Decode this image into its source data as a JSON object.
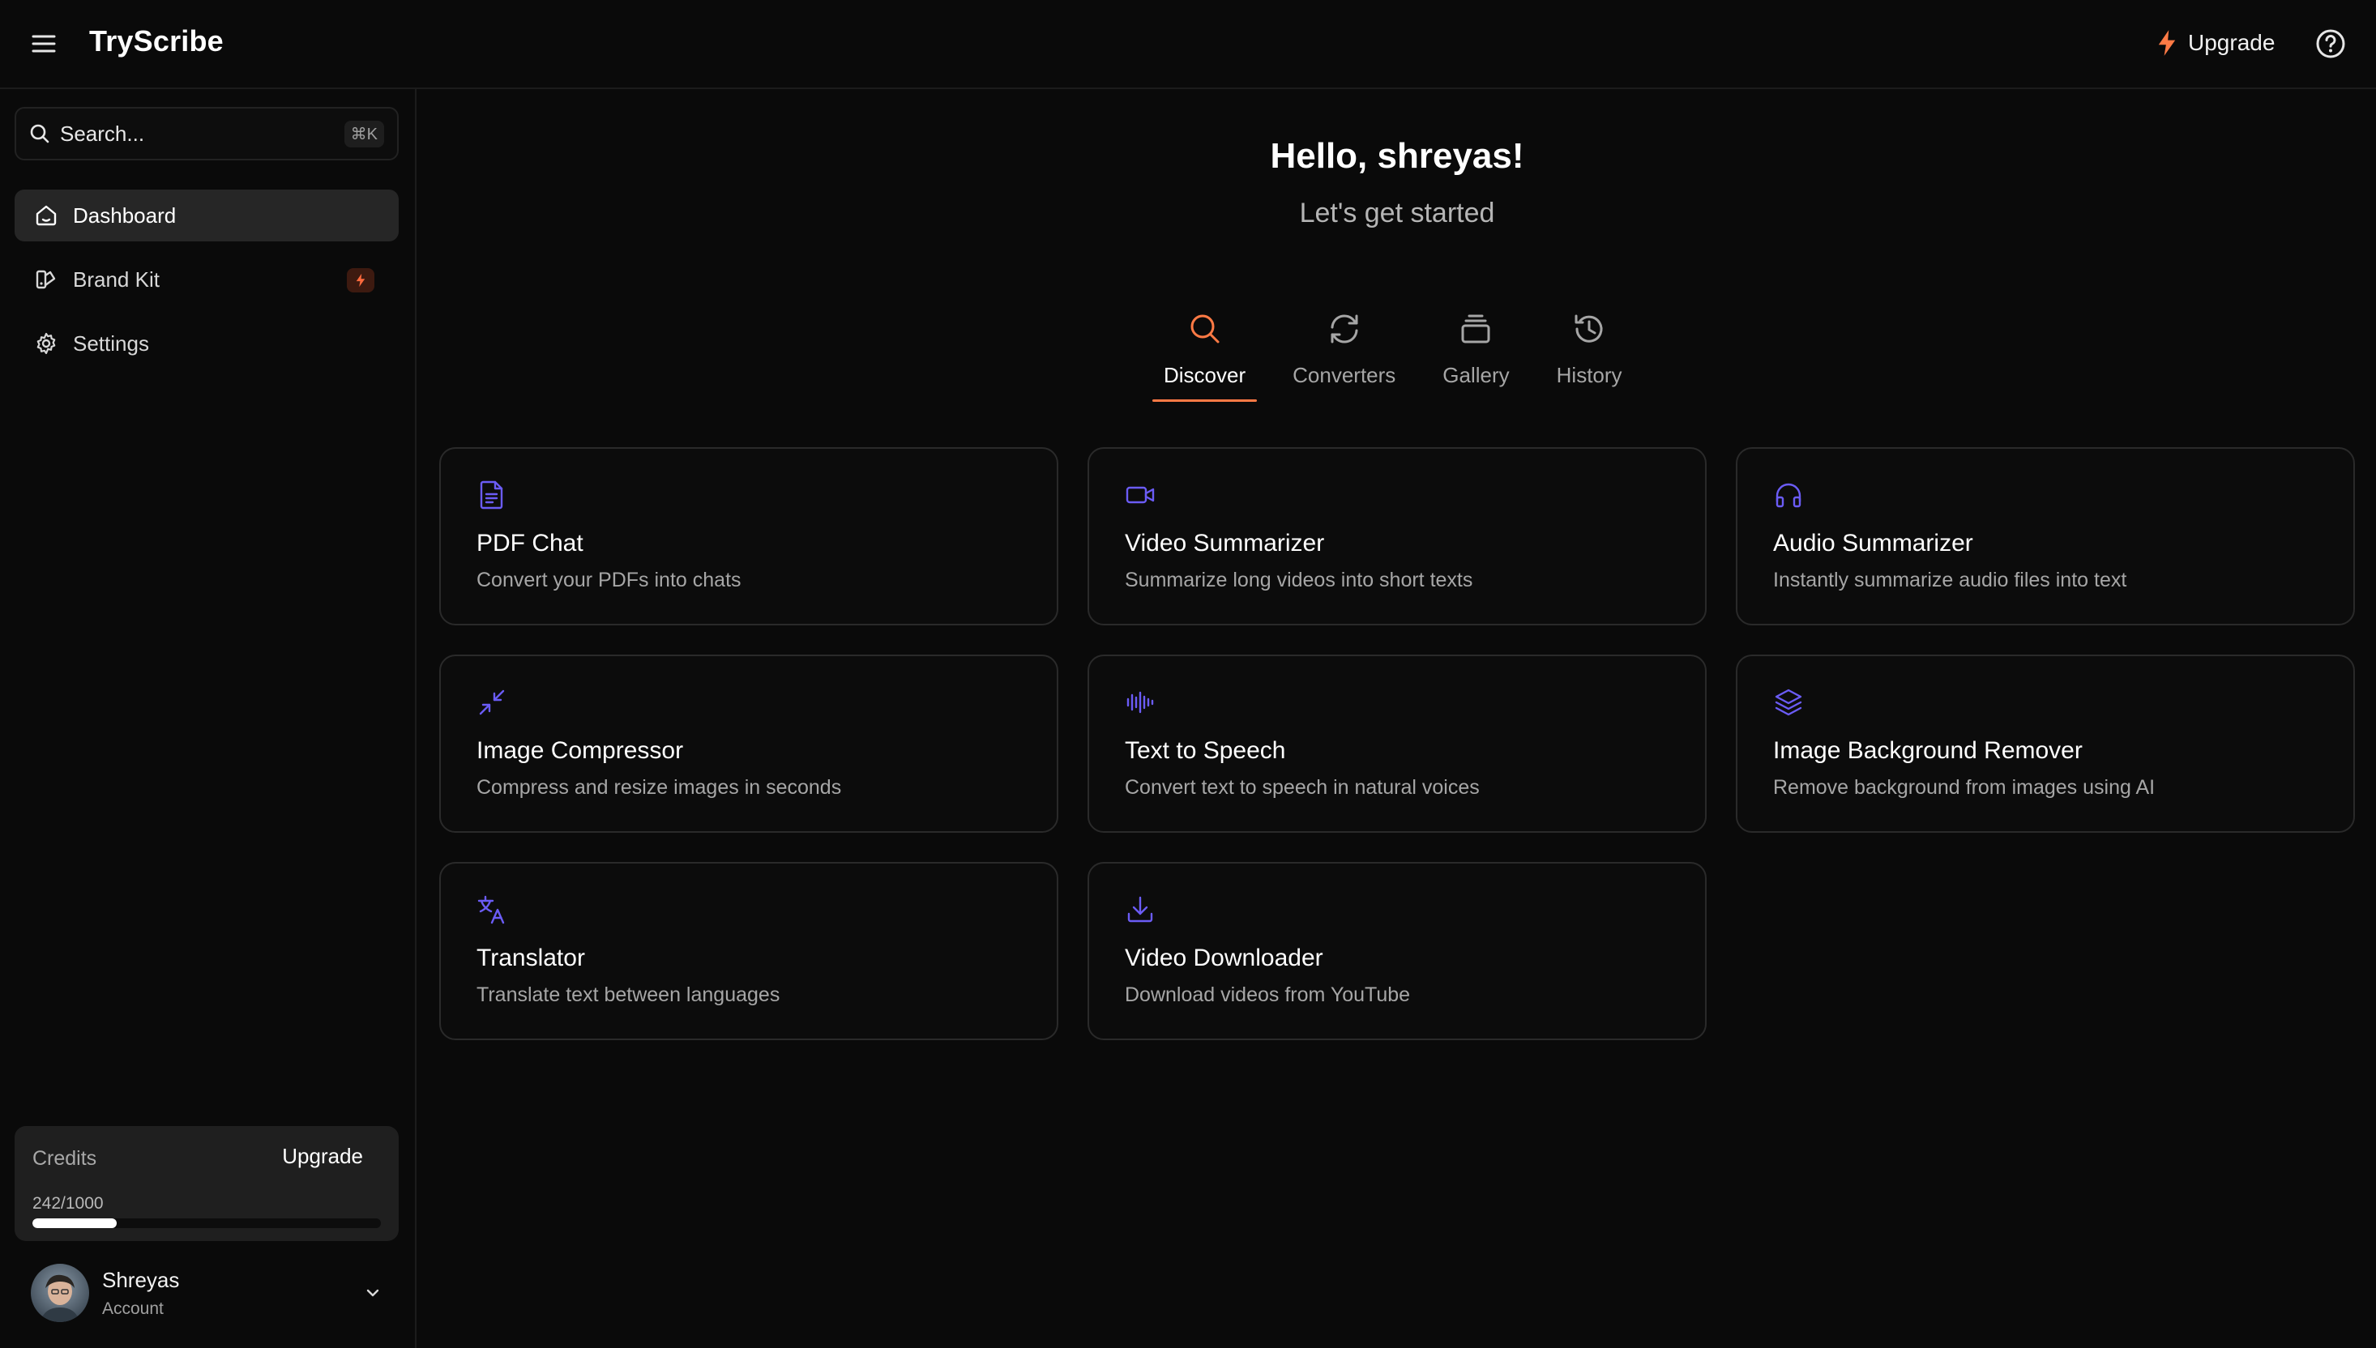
{
  "app": {
    "name": "TryScribe"
  },
  "header": {
    "upgrade_label": "Upgrade"
  },
  "sidebar": {
    "search": {
      "placeholder": "Search...",
      "shortcut": "⌘K"
    },
    "items": [
      {
        "label": "Dashboard",
        "icon": "home-icon",
        "active": true
      },
      {
        "label": "Brand Kit",
        "icon": "brand-kit-icon",
        "badge": "bolt-icon"
      },
      {
        "label": "Settings",
        "icon": "gear-icon"
      }
    ],
    "credits": {
      "label": "Credits",
      "upgrade_label": "Upgrade",
      "count": "242/1000",
      "used": 242,
      "total": 1000
    },
    "account": {
      "name": "Shreyas",
      "subtitle": "Account"
    }
  },
  "main": {
    "greeting": "Hello, shreyas!",
    "subtitle": "Let's get started",
    "tabs": [
      {
        "label": "Discover",
        "icon": "search-icon",
        "active": true
      },
      {
        "label": "Converters",
        "icon": "refresh-icon"
      },
      {
        "label": "Gallery",
        "icon": "gallery-icon"
      },
      {
        "label": "History",
        "icon": "history-icon"
      }
    ],
    "tools": [
      {
        "title": "PDF Chat",
        "description": "Convert your PDFs into chats",
        "icon": "file-text-icon"
      },
      {
        "title": "Video Summarizer",
        "description": "Summarize long videos into short texts",
        "icon": "video-icon"
      },
      {
        "title": "Audio Summarizer",
        "description": "Instantly summarize audio files into text",
        "icon": "headphones-icon"
      },
      {
        "title": "Image Compressor",
        "description": "Compress and resize images in seconds",
        "icon": "minimize-icon"
      },
      {
        "title": "Text to Speech",
        "description": "Convert text to speech in natural voices",
        "icon": "audio-waveform-icon"
      },
      {
        "title": "Image Background Remover",
        "description": "Remove background from images using AI",
        "icon": "layers-icon"
      },
      {
        "title": "Translator",
        "description": "Translate text between languages",
        "icon": "languages-icon"
      },
      {
        "title": "Video Downloader",
        "description": "Download videos from YouTube",
        "icon": "download-icon"
      }
    ]
  },
  "colors": {
    "accent": "#ff7a45",
    "icon_purple": "#6b5cf6",
    "background": "#0a0a0a",
    "card_border": "#2a2a2a"
  }
}
